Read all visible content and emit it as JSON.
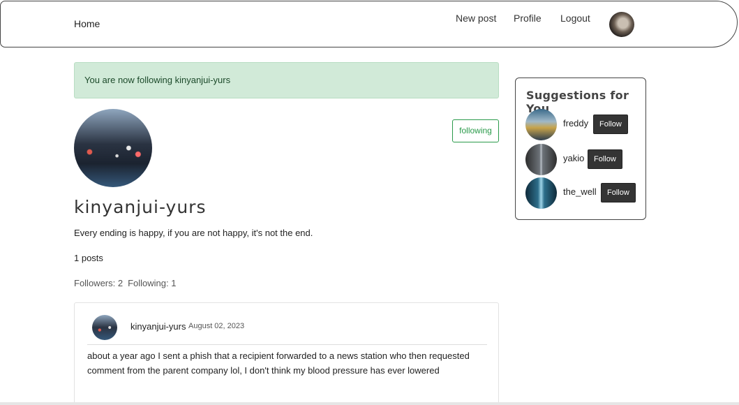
{
  "nav": {
    "home": "Home",
    "new_post": "New post",
    "profile": "Profile",
    "logout": "Logout"
  },
  "alert": {
    "message": "You are now following kinyanjui-yurs"
  },
  "profile": {
    "username": "kinyanjui-yurs",
    "bio": "Every ending is happy, if you are not happy, it's not the end.",
    "posts": "1 posts",
    "followers": "Followers: 2",
    "following": "Following: 1",
    "follow_state": "following"
  },
  "post": {
    "author": "kinyanjui-yurs",
    "date": "August 02, 2023",
    "body": "about a year ago I sent a phish that a recipient forwarded to a news station who then requested comment from the parent company lol, I don't think my blood pressure has ever lowered"
  },
  "suggestions": {
    "title": "Suggestions for You",
    "items": [
      {
        "name": "freddy",
        "button": "Follow"
      },
      {
        "name": "yakio",
        "button": "Follow"
      },
      {
        "name": "the_well",
        "button": "Follow"
      }
    ]
  }
}
